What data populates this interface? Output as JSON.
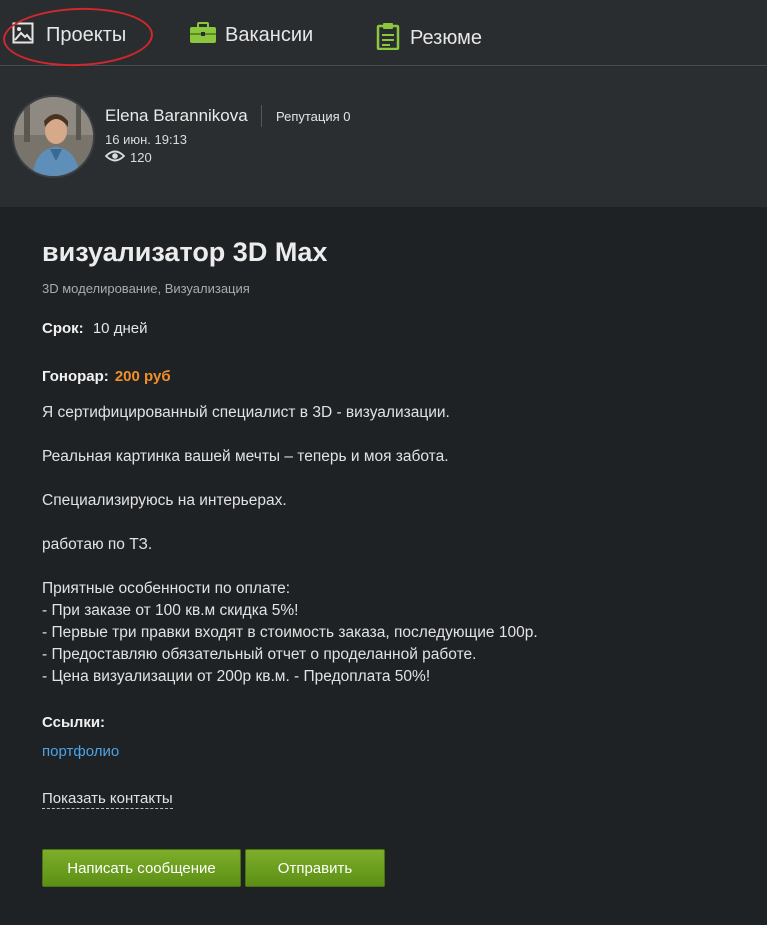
{
  "nav": {
    "projects": "Проекты",
    "vacancies": "Вакансии",
    "resume": "Резюме"
  },
  "author": {
    "name": "Elena Barannikova",
    "reputation": "Репутация 0",
    "date": "16 июн. 19:13",
    "views": "120"
  },
  "project": {
    "title": "визуализатор 3D Max",
    "categories": "3D моделирование, Визуализация",
    "term_label": "Срок:",
    "term_value": "10 дней",
    "fee_label": "Гонорар:",
    "fee_value": "200 руб",
    "description": [
      "Я сертифицированный специалист в 3D - визуализации.",
      "Реальная картинка вашей мечты – теперь и моя забота.",
      "Специализируюсь на интерьерах.",
      "работаю по ТЗ.",
      "Приятные особенности по оплате:",
      "- При заказе от 100 кв.м скидка 5%!",
      "- Первые три правки входят в стоимость заказа, последующие 100р.",
      "- Предоставляю обязательный отчет о проделанной работе.",
      "- Цена визуализации от 200р кв.м. - Предоплата 50%!"
    ],
    "links_label": "Ссылки:",
    "portfolio_link": "портфолио",
    "show_contacts": "Показать контакты"
  },
  "buttons": {
    "message": "Написать сообщение",
    "send": "Отправить"
  },
  "colors": {
    "background": "#1f2225",
    "accent_green": "#6a9e1f",
    "fee_orange": "#f08f2a",
    "link_blue": "#4da3e6",
    "annotation_red": "#d2272b"
  }
}
